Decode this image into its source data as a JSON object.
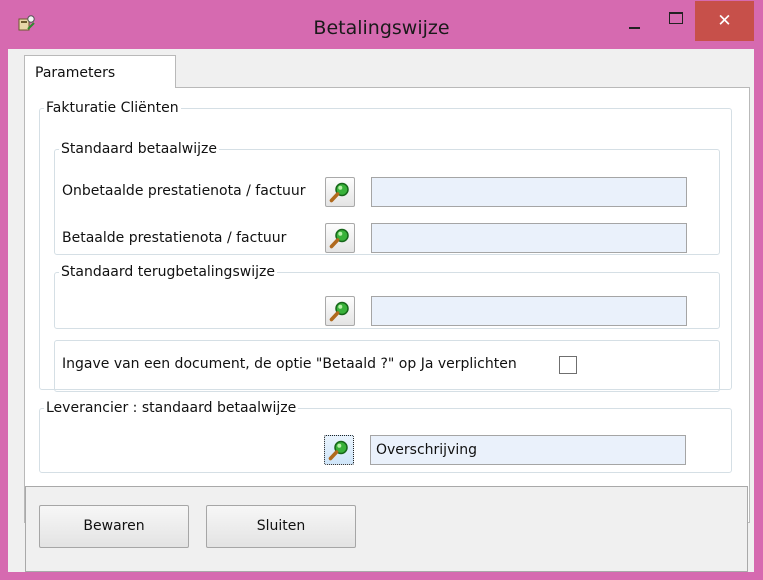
{
  "window": {
    "title": "Betalingswijze",
    "close_glyph": "✕",
    "accent_color": "#d66ab0",
    "close_color": "#c7504a"
  },
  "tabs": [
    {
      "label": "Parameters",
      "selected": true
    }
  ],
  "fakturatie": {
    "legend": "Fakturatie Cliënten",
    "standaard_betaalwijze": {
      "legend": "Standaard betaalwijze",
      "onbetaalde_label": "Onbetaalde prestatienota / factuur",
      "onbetaalde_value": "",
      "betaalde_label": "Betaalde prestatienota / factuur",
      "betaalde_value": ""
    },
    "terugbetaling": {
      "legend": "Standaard terugbetalingswijze",
      "value": ""
    },
    "verplicht": {
      "label": "Ingave van een document, de optie \"Betaald ?\" op Ja verplichten",
      "checked": false
    }
  },
  "leverancier": {
    "legend": "Leverancier : standaard betaalwijze",
    "value": "Overschrijving"
  },
  "buttons": {
    "save_label": "Bewaren",
    "close_label": "Sluiten"
  },
  "icons": {
    "lookup": "magnifier-icon",
    "app": "app-icon",
    "minimize": "minimize-icon",
    "maximize": "maximize-icon",
    "close": "close-icon"
  }
}
